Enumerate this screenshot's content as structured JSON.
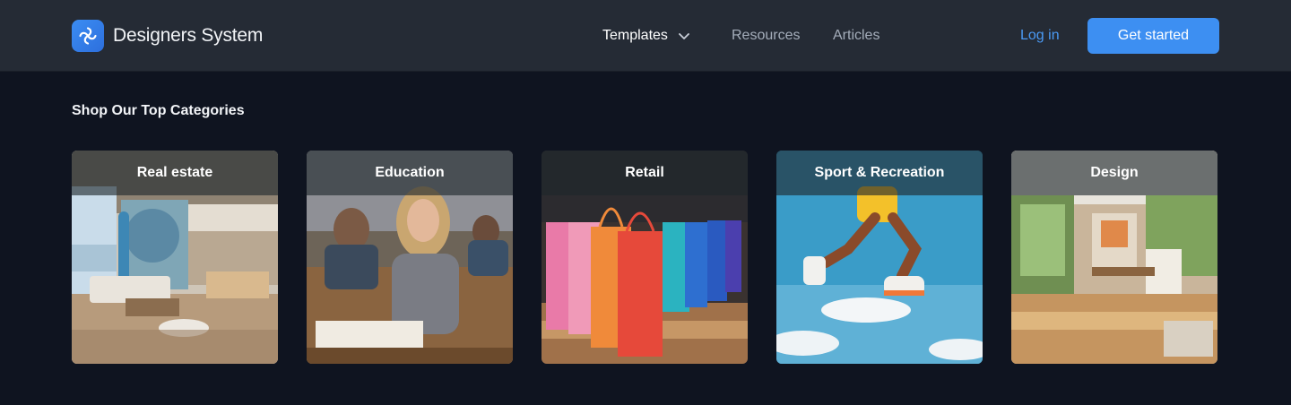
{
  "header": {
    "brand": "Designers System",
    "nav": {
      "templates": "Templates",
      "resources": "Resources",
      "articles": "Articles"
    },
    "login": "Log in",
    "cta": "Get started"
  },
  "section": {
    "title": "Shop Our Top Categories"
  },
  "categories": [
    {
      "label": "Real estate"
    },
    {
      "label": "Education"
    },
    {
      "label": "Retail"
    },
    {
      "label": "Sport & Recreation"
    },
    {
      "label": "Design"
    }
  ],
  "colors": {
    "background": "#0f1420",
    "header": "#252b35",
    "accent": "#3d8ff2",
    "link": "#4a9af5"
  }
}
